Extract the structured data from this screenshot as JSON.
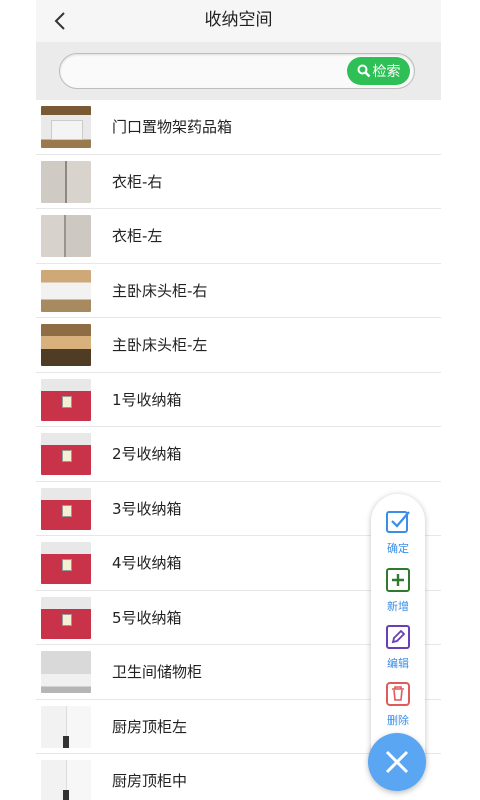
{
  "header": {
    "title": "收纳空间",
    "back_icon": "chevron-left-icon"
  },
  "search": {
    "value": "",
    "placeholder": "",
    "button_label": "检索",
    "button_color": "#2fbf57"
  },
  "list": {
    "items": [
      {
        "label": "门口置物架药品箱",
        "thumb": "shelf"
      },
      {
        "label": "衣柜-右",
        "thumb": "wardrobe"
      },
      {
        "label": "衣柜-左",
        "thumb": "wardrobe"
      },
      {
        "label": "主卧床头柜-右",
        "thumb": "nightstand"
      },
      {
        "label": "主卧床头柜-左",
        "thumb": "nightstand"
      },
      {
        "label": "1号收纳箱",
        "thumb": "storage-box"
      },
      {
        "label": "2号收纳箱",
        "thumb": "storage-box"
      },
      {
        "label": "3号收纳箱",
        "thumb": "storage-box"
      },
      {
        "label": "4号收纳箱",
        "thumb": "storage-box"
      },
      {
        "label": "5号收纳箱",
        "thumb": "storage-box"
      },
      {
        "label": "卫生间储物柜",
        "thumb": "bathroom-cabinet"
      },
      {
        "label": "厨房顶柜左",
        "thumb": "kitchen-cabinet"
      },
      {
        "label": "厨房顶柜中",
        "thumb": "kitchen-cabinet"
      }
    ]
  },
  "fab_menu": {
    "confirm": {
      "label": "确定",
      "icon": "checkbox-icon",
      "color": "#3a8ee6"
    },
    "add": {
      "label": "新增",
      "icon": "plus-square-icon",
      "color": "#2f7a2f"
    },
    "edit": {
      "label": "编辑",
      "icon": "pencil-icon",
      "color": "#6a3fb5"
    },
    "delete": {
      "label": "删除",
      "icon": "trash-icon",
      "color": "#e05a5a"
    },
    "close": {
      "icon": "close-icon",
      "color": "#5aa6f2"
    }
  }
}
